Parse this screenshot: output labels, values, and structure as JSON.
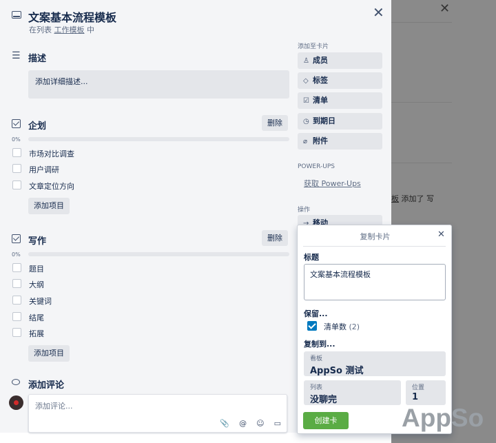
{
  "card": {
    "title": "文案基本流程模板",
    "sub_prefix": "在列表",
    "sub_list": "工作模板",
    "sub_suffix": "中",
    "close": "✕"
  },
  "description": {
    "title": "描述",
    "placeholder": "添加详细描述..."
  },
  "checklists": [
    {
      "title": "企划",
      "delete": "删除",
      "percent": "0%",
      "items": [
        "市场对比调查",
        "用户调研",
        "文章定位方向"
      ],
      "add_item": "添加项目"
    },
    {
      "title": "写作",
      "delete": "删除",
      "percent": "0%",
      "items": [
        "题目",
        "大纲",
        "关键词",
        "结尾",
        "拓展"
      ],
      "add_item": "添加项目"
    }
  ],
  "comment": {
    "title": "添加评论",
    "placeholder": "添加评论...",
    "tools": [
      "📎",
      "@",
      "☺",
      "▭"
    ]
  },
  "sidebar": {
    "add_to_card": "添加至卡片",
    "buttons": [
      {
        "icon": "♙",
        "label": "成员"
      },
      {
        "icon": "◇",
        "label": "标签"
      },
      {
        "icon": "☑",
        "label": "清单"
      },
      {
        "icon": "◷",
        "label": "到期日"
      },
      {
        "icon": "⌀",
        "label": "附件"
      }
    ],
    "powerups_head": "POWER-UPS",
    "powerups_link": "获取 Power-Ups",
    "actions_head": "操作",
    "move": {
      "icon": "→",
      "label": "移动"
    }
  },
  "background": {
    "close": "✕",
    "text_link": "板",
    "text_rest": " 添加了 写"
  },
  "copy_popover": {
    "title": "复制卡片",
    "close": "✕",
    "title_label": "标题",
    "title_value": "文案基本流程模板",
    "keep_label": "保留...",
    "keep_item": "清单数",
    "keep_count": "(2)",
    "copy_to_label": "复制到...",
    "board_label": "看板",
    "board_value": "AppSo 测试",
    "list_label": "列表",
    "list_value": "没聊完",
    "position_label": "位置",
    "position_value": "1",
    "create_button": "创建卡"
  },
  "watermark": "AppSo"
}
